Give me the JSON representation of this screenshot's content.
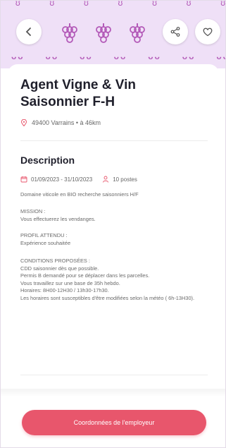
{
  "colors": {
    "header_bg": "#efe0f7",
    "accent_purple": "#b35ab8",
    "cta_red": "#e8566c"
  },
  "header": {
    "back_icon": "arrow-left-icon",
    "share_icon": "share-icon",
    "favorite_icon": "heart-icon",
    "pattern_icon": "grape-icon"
  },
  "job": {
    "title": "Agent Vigne & Vin Saisonnier F-H",
    "location": "49400 Varrains • à 46km"
  },
  "description": {
    "heading": "Description",
    "dates": "01/09/2023 - 31/10/2023",
    "positions": "10 postes",
    "intro": "Domaine viticole en BIO recherche saisonniers H/F",
    "mission_title": "MISSION :",
    "mission_text": "Vous effectuerez les vendanges.",
    "profile_title": "PROFIL ATTENDU :",
    "profile_text": "Expérience souhaitée",
    "conditions_title": "CONDITIONS PROPOSÉES :",
    "conditions_lines": [
      "CDD saisonnier dès que possible.",
      "Permis B demandé pour se déplacer dans les parcelles.",
      "Vous travaillez sur une base de 35h hebdo.",
      "Horaires: 8H00-12H30 / 13h30-17h30.",
      "Les horaires sont susceptibles d'être modifiées selon la météo ( 6h-13H30)."
    ]
  },
  "cta": {
    "label": "Coordonnées de l'employeur"
  }
}
